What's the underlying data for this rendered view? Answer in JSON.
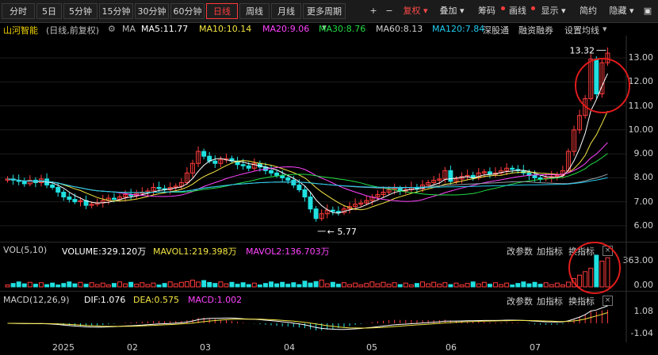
{
  "toolbar": {
    "periods": [
      "分时",
      "5日",
      "5分钟",
      "15分钟",
      "30分钟",
      "60分钟",
      "日线",
      "周线",
      "月线",
      "更多周期"
    ],
    "active_period": "日线",
    "plus": "+",
    "minus": "−",
    "fuquan": "复权",
    "diejia": "叠加",
    "chouma": "筹码",
    "huaxian": "画线",
    "xianshi": "显示",
    "jianyue": "简约",
    "yincang": "隐藏"
  },
  "stock": {
    "name": "山河智能",
    "mode": "(日线,前复权)",
    "ma_label": "MA",
    "ma5": "MA5:11.77",
    "ma10": "MA10:10.14",
    "ma20": "MA20:9.06",
    "ma30": "MA30:8.76",
    "ma60": "MA60:8.13",
    "ma120": "MA120:7.84",
    "shengu": "深股通",
    "rongzi": "融资融券",
    "setting": "设置均线",
    "high_label": "13.32",
    "low_label": "5.77"
  },
  "price_axis": [
    "13.00",
    "12.00",
    "11.00",
    "10.00",
    "9.00",
    "8.00",
    "7.00",
    "6.00"
  ],
  "volume": {
    "title": "VOL(5,10)",
    "volume": "VOLUME:329.120万",
    "mavol1": "MAVOL1:219.398万",
    "mavol2": "MAVOL2:136.703万",
    "axis": [
      "363.00",
      "0.00"
    ],
    "btn_param": "改参数",
    "btn_add": "加指标",
    "btn_switch": "换指标"
  },
  "macd": {
    "title": "MACD(12,26,9)",
    "dif": "DIF:1.076",
    "dea": "DEA:0.575",
    "macd": "MACD:1.002",
    "axis": [
      "1.08",
      "-1.04"
    ],
    "btn_param": "改参数",
    "btn_add": "加指标",
    "btn_switch": "换指标"
  },
  "x_axis": [
    "2025",
    "02",
    "03",
    "04",
    "05",
    "06",
    "07"
  ],
  "colors": {
    "up": "#ff3b3b",
    "down": "#20e0e0",
    "ma5": "#ffffff",
    "ma10": "#f5e642",
    "ma20": "#ff44ff",
    "ma30": "#22dd44",
    "ma60": "#9aa0a8",
    "ma120": "#22ccee"
  },
  "chart_data": {
    "type": "candlestick",
    "title": "山河智能 (日线,前复权)",
    "ylim": [
      5.5,
      13.5
    ],
    "closes": [
      7.95,
      7.9,
      7.85,
      7.75,
      7.9,
      7.8,
      7.95,
      7.7,
      7.6,
      7.4,
      7.2,
      7.1,
      7.0,
      7.05,
      6.85,
      6.9,
      6.95,
      7.05,
      7.15,
      7.1,
      7.2,
      7.3,
      7.25,
      7.35,
      7.4,
      7.45,
      7.6,
      7.55,
      7.5,
      7.6,
      7.65,
      7.8,
      8.2,
      8.6,
      9.1,
      8.9,
      8.7,
      8.6,
      8.75,
      8.8,
      8.7,
      8.55,
      8.5,
      8.4,
      8.6,
      8.45,
      8.3,
      8.2,
      8.1,
      8.0,
      7.9,
      7.7,
      7.5,
      7.2,
      6.7,
      6.3,
      6.5,
      6.65,
      6.6,
      6.55,
      6.7,
      6.8,
      6.9,
      6.95,
      7.05,
      7.2,
      7.3,
      7.4,
      7.5,
      7.55,
      7.45,
      7.5,
      7.6,
      7.55,
      7.7,
      7.8,
      7.9,
      7.95,
      8.3,
      7.85,
      7.95,
      8.05,
      8.1,
      8.0,
      8.2,
      8.25,
      8.15,
      8.2,
      8.3,
      8.4,
      8.35,
      8.3,
      8.2,
      8.1,
      8.0,
      7.95,
      8.0,
      8.05,
      8.1,
      8.3,
      9.1,
      10.0,
      10.6,
      11.3,
      12.95,
      11.5,
      12.8,
      13.2
    ]
  }
}
